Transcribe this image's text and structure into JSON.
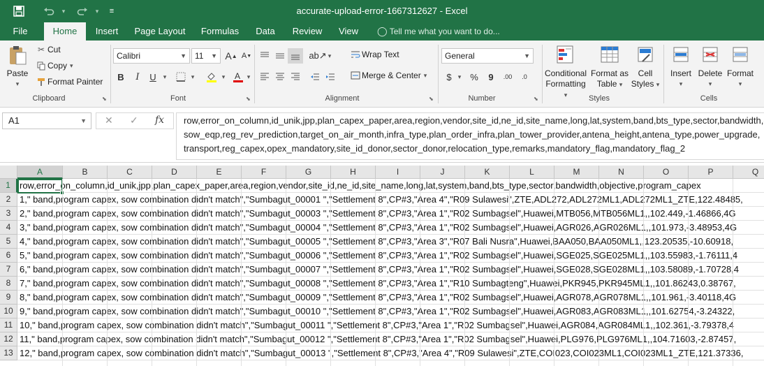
{
  "app": {
    "window_title": "accurate-upload-error-1667312627 - Excel",
    "accent_color": "#217346"
  },
  "quick_access": {
    "save_icon": "save-icon",
    "undo_icon": "undo-icon",
    "redo_icon": "redo-icon"
  },
  "tabs": {
    "file": "File",
    "home": "Home",
    "insert": "Insert",
    "page_layout": "Page Layout",
    "formulas": "Formulas",
    "data": "Data",
    "review": "Review",
    "view": "View",
    "tell_me": "Tell me what you want to do..."
  },
  "ribbon": {
    "clipboard": {
      "paste": "Paste",
      "cut": "Cut",
      "copy": "Copy",
      "format_painter": "Format Painter",
      "label": "Clipboard"
    },
    "font": {
      "name": "Calibri",
      "size": "11",
      "bold": "B",
      "italic": "I",
      "underline": "U",
      "grow": "A",
      "shrink": "A",
      "label": "Font"
    },
    "alignment": {
      "wrap_text": "Wrap Text",
      "merge_center": "Merge & Center",
      "label": "Alignment"
    },
    "number": {
      "format": "General",
      "currency": "$",
      "percent": "%",
      "comma": "9",
      "inc_decimal": ".00",
      "dec_decimal": ".0",
      "label": "Number"
    },
    "styles": {
      "conditional_1": "Conditional",
      "conditional_2": "Formatting",
      "format_table_1": "Format as",
      "format_table_2": "Table",
      "cell_styles_1": "Cell",
      "cell_styles_2": "Styles",
      "label": "Styles"
    },
    "cells": {
      "insert": "Insert",
      "delete": "Delete",
      "format": "Format",
      "label": "Cells"
    }
  },
  "formula_bar": {
    "name_box": "A1",
    "cancel": "✕",
    "enter": "✓",
    "fx": "fx",
    "lines": [
      "row,error_on_column,id_unik,jpp,plan_capex_paper,area,region,vendor,site_id,ne_id,site_name,long,lat,system,band,bts_type,sector,bandwidth,objective,program_capex,",
      "sow_eqp,reg_rev_prediction,target_on_air_month,infra_type,plan_order_infra,plan_tower_provider,antena_height,antena_type,power_upgrade,",
      "transport,reg_capex,opex_mandatory,site_id_donor,sector_donor,relocation_type,remarks,mandatory_flag,mandatory_flag_2"
    ]
  },
  "grid": {
    "columns": [
      "A",
      "B",
      "C",
      "D",
      "E",
      "F",
      "G",
      "H",
      "I",
      "J",
      "K",
      "L",
      "M",
      "N",
      "O",
      "P",
      "Q"
    ],
    "row_numbers": [
      "1",
      "2",
      "3",
      "4",
      "5",
      "6",
      "7",
      "8",
      "9",
      "10",
      "11",
      "12",
      "13"
    ],
    "rows": [
      "row,error_on_column,id_unik,jpp,plan_capex_paper,area,region,vendor,site_id,ne_id,site_name,long,lat,system,band,bts_type,sector,bandwidth,objective,program_capex",
      "1,\" band,program capex, sow combination didn't match\",\"Sumbagut_00001 \",\"Settlement 8\",CP#3,\"Area 4\",\"R09 Sulawesi\",ZTE,ADL272,ADL272ML1,ADL272ML1_ZTE,122.48485,",
      "2,\" band,program capex, sow combination didn't match\",\"Sumbagut_00003 \",\"Settlement 8\",CP#3,\"Area 1\",\"R02 Sumbagsel\",Huawei,MTB056,MTB056ML1,,102.449,-1.46866,4G",
      "3,\" band,program capex, sow combination didn't match\",\"Sumbagut_00004 \",\"Settlement 8\",CP#3,\"Area 1\",\"R02 Sumbagsel\",Huawei,AGR026,AGR026ML1,,101.973,-3.48953,4G",
      "4,\" band,program capex, sow combination didn't match\",\"Sumbagut_00005 \",\"Settlement 8\",CP#3,\"Area 3\",\"R07 Bali Nusra\",Huawei,BAA050,BAA050ML1,,123.20535,-10.60918,",
      "5,\" band,program capex, sow combination didn't match\",\"Sumbagut_00006 \",\"Settlement 8\",CP#3,\"Area 1\",\"R02 Sumbagsel\",Huawei,SGE025,SGE025ML1,,103.55983,-1.76111,4",
      "6,\" band,program capex, sow combination didn't match\",\"Sumbagut_00007 \",\"Settlement 8\",CP#3,\"Area 1\",\"R02 Sumbagsel\",Huawei,SGE028,SGE028ML1,,103.58089,-1.70728,4",
      "7,\" band,program capex, sow combination didn't match\",\"Sumbagut_00008 \",\"Settlement 8\",CP#3,\"Area 1\",\"R10 Sumbagteng\",Huawei,PKR945,PKR945ML1,,101.86243,0.38767,",
      "8,\" band,program capex, sow combination didn't match\",\"Sumbagut_00009 \",\"Settlement 8\",CP#3,\"Area 1\",\"R02 Sumbagsel\",Huawei,AGR078,AGR078ML1,,101.961,-3.40118,4G",
      "9,\" band,program capex, sow combination didn't match\",\"Sumbagut_00010 \",\"Settlement 8\",CP#3,\"Area 1\",\"R02 Sumbagsel\",Huawei,AGR083,AGR083ML1,,101.62754,-3.24322,",
      "10,\" band,program capex, sow combination didn't match\",\"Sumbagut_00011 \",\"Settlement 8\",CP#3,\"Area 1\",\"R02 Sumbagsel\",Huawei,AGR084,AGR084ML1,,102.361,-3.79378,4",
      "11,\" band,program capex, sow combination didn't match\",\"Sumbagut_00012 \",\"Settlement 8\",CP#3,\"Area 1\",\"R02 Sumbagsel\",Huawei,PLG976,PLG976ML1,,104.71603,-2.87457,",
      "12,\" band,program capex, sow combination didn't match\",\"Sumbagut_00013 \",\"Settlement 8\",CP#3,\"Area 4\",\"R09 Sulawesi\",ZTE,COI023,COI023ML1,COI023ML1_ZTE,121.37336,"
    ]
  }
}
